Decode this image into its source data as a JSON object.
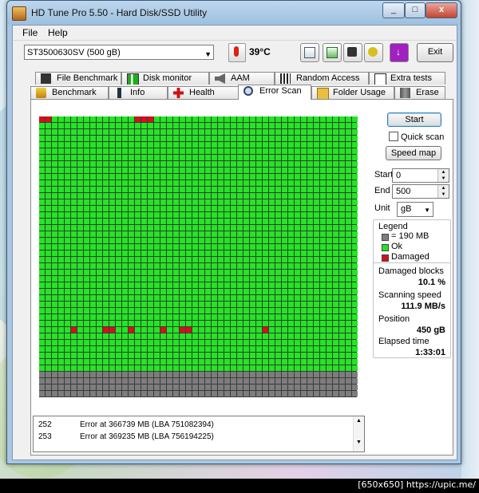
{
  "window": {
    "title": "HD Tune Pro 5.50 - Hard Disk/SSD Utility",
    "minimize": "_",
    "maximize": "□",
    "close": "x"
  },
  "menu": {
    "file": "File",
    "help": "Help"
  },
  "toolbar": {
    "drive": "ST3500630SV (500 gB)",
    "temperature": "39",
    "temperature_unit": "°C",
    "exit_label": "Exit"
  },
  "tabs_row1": [
    "File Benchmark",
    "Disk monitor",
    "AAM",
    "Random Access",
    "Extra tests"
  ],
  "tabs_row2": [
    "Benchmark",
    "Info",
    "Health",
    "Error Scan",
    "Folder Usage",
    "Erase"
  ],
  "active_tab": "Error Scan",
  "controls": {
    "start_label": "Start",
    "quick_scan_label": "Quick scan",
    "quick_scan_checked": false,
    "speed_map_label": "Speed map",
    "start_field_label": "Start",
    "start_value": "0",
    "end_field_label": "End",
    "end_value": "500",
    "unit_label": "Unit",
    "unit_value": "gB"
  },
  "legend": {
    "title": "Legend",
    "block_size": "= 190 MB",
    "ok": "Ok",
    "damaged": "Damaged",
    "colors": {
      "unscanned": "#7d7d7d",
      "ok": "#22e622",
      "damaged": "#d4101a"
    }
  },
  "stats": {
    "damaged_blocks_label": "Damaged blocks",
    "damaged_blocks_value": "10.1 %",
    "scanning_speed_label": "Scanning speed",
    "scanning_speed_value": "111.9 MB/s",
    "position_label": "Position",
    "position_value": "450 gB",
    "elapsed_label": "Elapsed time",
    "elapsed_value": "1:33:01"
  },
  "scan_grid": {
    "cols": 50,
    "rows": 44,
    "scanned_rows": 40,
    "damaged_cells": [
      [
        0,
        0
      ],
      [
        0,
        1
      ],
      [
        0,
        15
      ],
      [
        0,
        16
      ],
      [
        0,
        17
      ],
      [
        33,
        5
      ],
      [
        33,
        10
      ],
      [
        33,
        11
      ],
      [
        33,
        14
      ],
      [
        33,
        19
      ],
      [
        33,
        22
      ],
      [
        33,
        23
      ],
      [
        33,
        35
      ]
    ]
  },
  "log": [
    {
      "num": "252",
      "text": "Error at 366739 MB (LBA 751082394)"
    },
    {
      "num": "253",
      "text": "Error at 369235 MB (LBA 756194225)"
    }
  ],
  "watermark": "[650x650] https://upic.me/"
}
